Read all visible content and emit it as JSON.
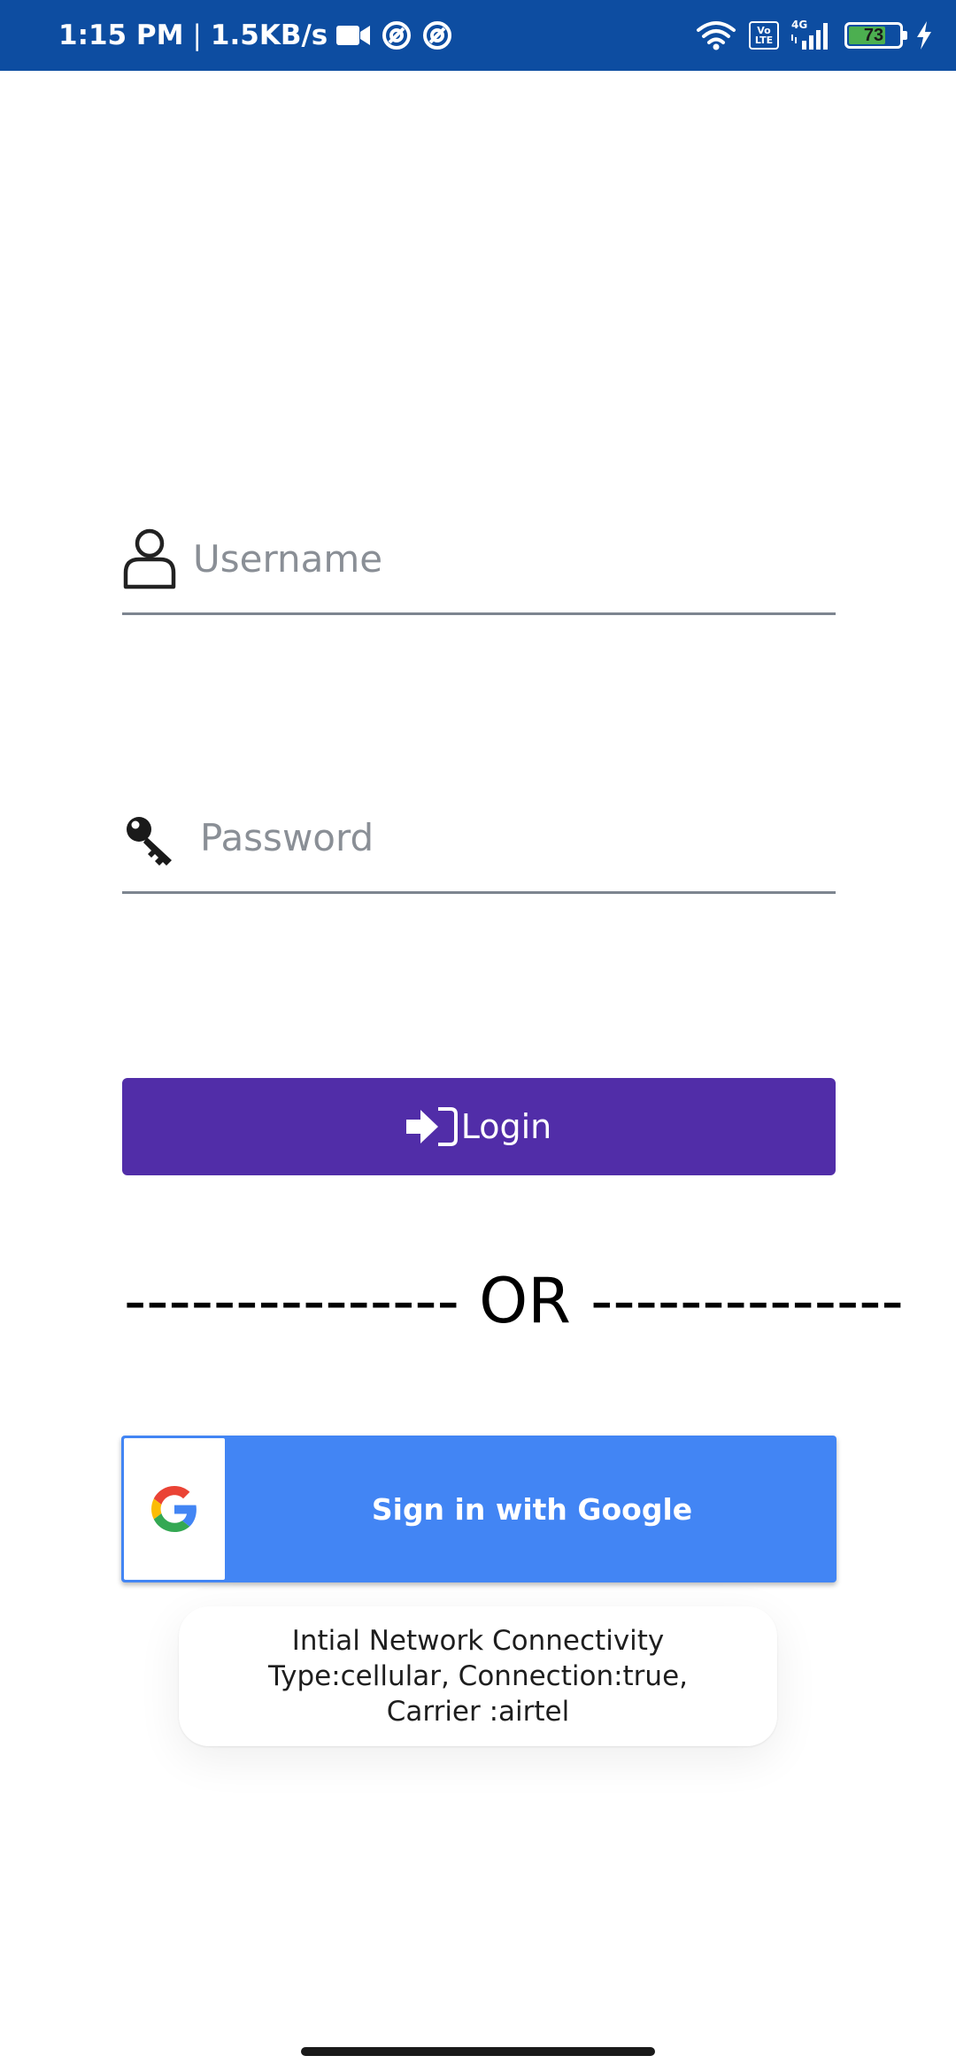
{
  "status_bar": {
    "time": "1:15 PM",
    "separator": "|",
    "net_speed": "1.5KB/s",
    "battery_level": 73,
    "battery_text": "73",
    "network_type": "4G",
    "volte_label_top": "Vo",
    "volte_label_bottom": "LTE",
    "bg_color": "#0d4da1",
    "icons": [
      "video-camera-icon",
      "data-saver-icon",
      "data-saver-icon",
      "wifi-icon",
      "volte-icon",
      "signal-icon",
      "battery-icon",
      "charging-bolt-icon"
    ]
  },
  "form": {
    "username": {
      "placeholder": "Username",
      "value": "",
      "icon": "user-icon"
    },
    "password": {
      "placeholder": "Password",
      "value": "",
      "icon": "key-icon"
    },
    "underline_color": "#7d8590"
  },
  "login_button": {
    "label": "Login",
    "icon": "login-icon",
    "color": "#512da8"
  },
  "divider": {
    "text": "--------------- OR --------------"
  },
  "google_button": {
    "label": "Sign in with Google",
    "icon": "google-logo-icon",
    "color": "#4285f4"
  },
  "toast": {
    "line1": "Intial Network Connectivity",
    "line2": "Type:cellular, Connection:true,",
    "line3": "Carrier :airtel"
  }
}
